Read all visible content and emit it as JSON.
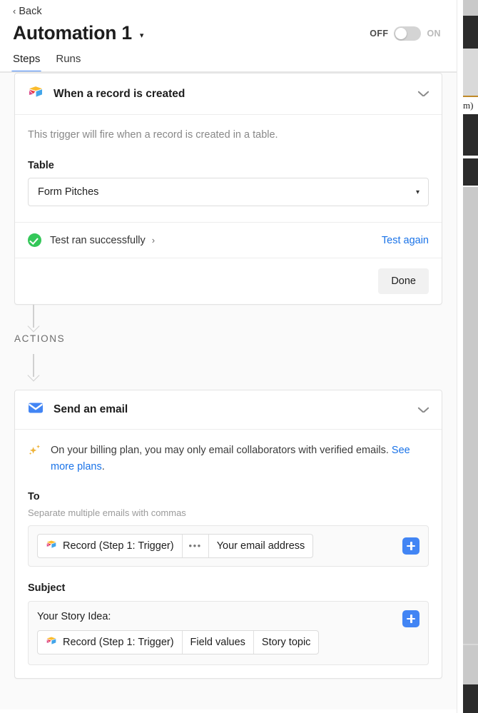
{
  "header": {
    "back_label": "Back",
    "back_chevron": "‹",
    "title": "Automation 1",
    "title_caret": "▾",
    "toggle": {
      "off_label": "OFF",
      "on_label": "ON",
      "state": "off"
    }
  },
  "tabs": [
    {
      "label": "Steps",
      "active": true
    },
    {
      "label": "Runs",
      "active": false
    }
  ],
  "trigger_card": {
    "icon": "airtable-record-icon",
    "title": "When a record is created",
    "chevron": "chevron-down-icon",
    "description": "This trigger will fire when a record is created in a table.",
    "table_field": {
      "label": "Table",
      "value": "Form Pitches",
      "caret": "▾"
    },
    "test_status": {
      "icon": "success-check-icon",
      "text": "Test ran successfully",
      "arrow": "›",
      "action_link": "Test again"
    },
    "done_button": "Done"
  },
  "actions_section": {
    "label": "ACTIONS"
  },
  "email_card": {
    "icon": "envelope-icon",
    "title": "Send an email",
    "chevron": "chevron-down-icon",
    "notice": {
      "icon": "sparkle-icon",
      "text_before": "On your billing plan, you may only email collaborators with verified emails. ",
      "link": "See more plans",
      "text_after": "."
    },
    "to_field": {
      "label": "To",
      "hint": "Separate multiple emails with commas",
      "tokens": [
        {
          "icon": "airtable-record-icon",
          "label": "Record (Step 1: Trigger)"
        },
        {
          "icon": "ellipsis-icon",
          "label": "•••"
        },
        {
          "icon": null,
          "label": "Your email address"
        }
      ],
      "add_button": "add-token-button"
    },
    "subject_field": {
      "label": "Subject",
      "text_line": "Your Story Idea:",
      "tokens": [
        {
          "icon": "airtable-record-icon",
          "label": "Record (Step 1: Trigger)"
        },
        {
          "icon": null,
          "label": "Field values"
        },
        {
          "icon": null,
          "label": "Story topic"
        }
      ],
      "add_button": "add-token-button"
    }
  },
  "background_window": {
    "partial_text": "m)"
  },
  "colors": {
    "accent_blue": "#4285f4",
    "link_blue": "#1a73e8",
    "success_green": "#34c759",
    "page_bg": "#fafafa",
    "sparkle_gold": "#eeb33a"
  }
}
